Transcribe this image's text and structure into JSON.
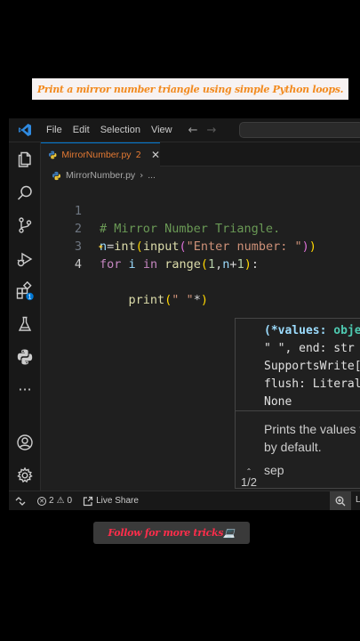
{
  "banner": {
    "text": "Print a mirror number triangle using simple Python loops."
  },
  "menu": {
    "items": [
      "File",
      "Edit",
      "Selection",
      "View"
    ]
  },
  "tab": {
    "name": "MirrorNumber.py",
    "problem_count": "2"
  },
  "breadcrumb": {
    "file": "MirrorNumber.py",
    "sep": "›",
    "more": "..."
  },
  "editor": {
    "line_numbers": [
      "1",
      "2",
      "3",
      "4"
    ],
    "lines": [
      "# Mirror Number Triangle.",
      "n=int(input(\"Enter number: \"))",
      "for i in range(1,n+1):",
      "    print(\" \"*)"
    ]
  },
  "hover": {
    "signature": [
      "(*values: object,",
      "\" \", end: str | Ne",
      "SupportsWrite[str",
      "flush: Literal[Fal",
      "None"
    ],
    "doc": [
      "Prints the values to a",
      "by default."
    ],
    "param": "sep",
    "pager": "1/2"
  },
  "status": {
    "errors": "2",
    "warnings": "0",
    "live_share": "Live Share",
    "edge": "L"
  },
  "follow": {
    "text": "Follow for more tricks💻"
  },
  "colors": {
    "accent": "#0078d4",
    "tab_text": "#e37933",
    "banner_text": "#f28a1e",
    "follow_text": "#ff2d4b"
  }
}
